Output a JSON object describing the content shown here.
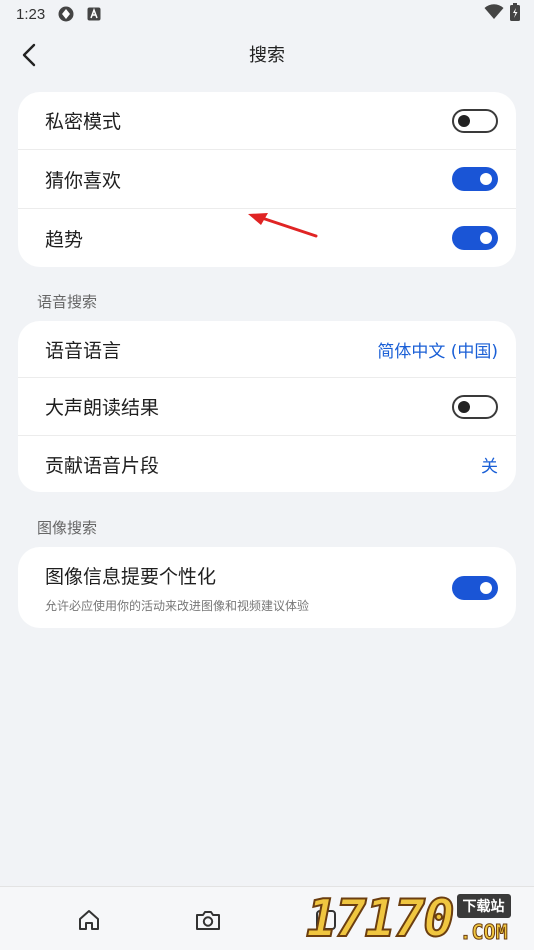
{
  "status_bar": {
    "time": "1:23"
  },
  "header": {
    "title": "搜索"
  },
  "cards": {
    "general": [
      {
        "label": "私密模式",
        "toggle": false
      },
      {
        "label": "猜你喜欢",
        "toggle": true
      },
      {
        "label": "趋势",
        "toggle": true
      }
    ],
    "voice": {
      "section_title": "语音搜索",
      "voice_language": {
        "label": "语音语言",
        "value": "简体中文 (中国)"
      },
      "read_aloud": {
        "label": "大声朗读结果",
        "toggle": false
      },
      "contribute": {
        "label": "贡献语音片段",
        "value": "关"
      }
    },
    "image": {
      "section_title": "图像搜索",
      "personalize": {
        "label": "图像信息提要个性化",
        "sub": "允许必应使用你的活动来改进图像和视频建议体验",
        "toggle": true
      }
    }
  },
  "colors": {
    "accent": "#1a55d6",
    "background": "#f1f3f6",
    "annotation_arrow": "#e02424"
  },
  "bottom_nav": [
    "home-icon",
    "camera-icon",
    "tabs-icon",
    "apps-icon"
  ],
  "tabs_count": "0",
  "watermark": {
    "number": "17170",
    "tag": "下载站",
    "domain": ".COM"
  }
}
